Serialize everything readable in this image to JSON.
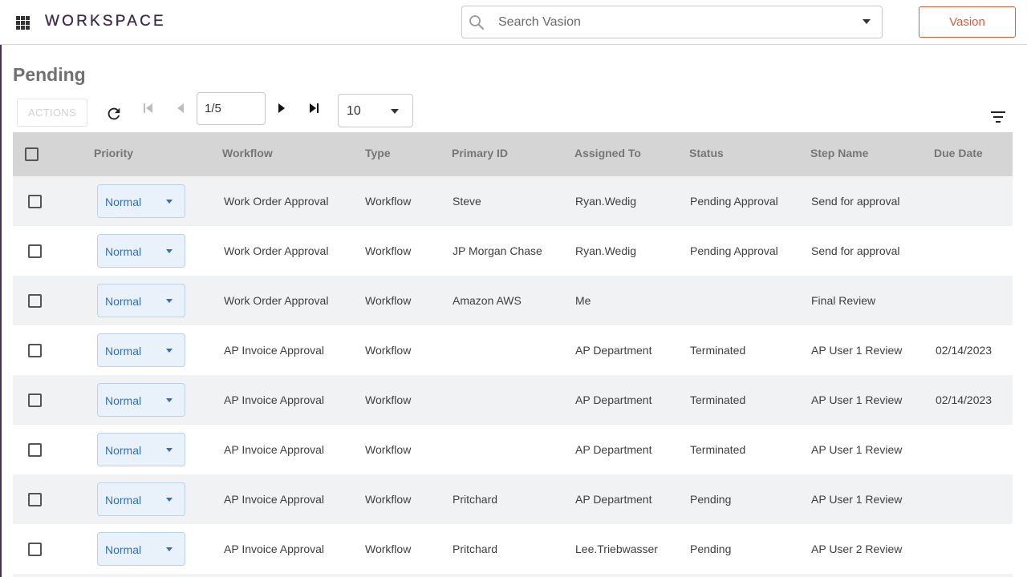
{
  "header": {
    "brand": "WORKSPACE",
    "search_placeholder": "Search Vasion",
    "vasion_label": "Vasion"
  },
  "page": {
    "title": "Pending"
  },
  "toolbar": {
    "actions_label": "ACTIONS",
    "page_value": "1/5",
    "page_size": "10"
  },
  "icons": {
    "apps": "apps-grid-icon",
    "search": "search-icon",
    "refresh": "refresh-icon",
    "first": "first-page-icon",
    "prev": "previous-page-icon",
    "next": "next-page-icon",
    "last": "last-page-icon",
    "filter": "filter-icon"
  },
  "colors": {
    "brand": "#3b2a4e",
    "accent": "#e2593a",
    "priority_text": "#2f6fc0",
    "header_bg": "#d5d5d5",
    "row_alt_bg": "#f1f2f4"
  },
  "table": {
    "columns": [
      "Priority",
      "Workflow",
      "Type",
      "Primary ID",
      "Assigned To",
      "Status",
      "Step Name",
      "Due Date"
    ],
    "rows": [
      {
        "priority": "Normal",
        "workflow": "Work Order Approval",
        "type": "Workflow",
        "primary_id": "Steve",
        "assigned_to": "Ryan.Wedig",
        "status": "Pending Approval",
        "step_name": "Send for approval",
        "due_date": ""
      },
      {
        "priority": "Normal",
        "workflow": "Work Order Approval",
        "type": "Workflow",
        "primary_id": "JP Morgan Chase",
        "assigned_to": "Ryan.Wedig",
        "status": "Pending Approval",
        "step_name": "Send for approval",
        "due_date": ""
      },
      {
        "priority": "Normal",
        "workflow": "Work Order Approval",
        "type": "Workflow",
        "primary_id": "Amazon AWS",
        "assigned_to": "Me",
        "status": "",
        "step_name": "Final Review",
        "due_date": ""
      },
      {
        "priority": "Normal",
        "workflow": "AP Invoice Approval",
        "type": "Workflow",
        "primary_id": "",
        "assigned_to": "AP Department",
        "status": "Terminated",
        "step_name": "AP User 1 Review",
        "due_date": "02/14/2023"
      },
      {
        "priority": "Normal",
        "workflow": "AP Invoice Approval",
        "type": "Workflow",
        "primary_id": "",
        "assigned_to": "AP Department",
        "status": "Terminated",
        "step_name": "AP User 1 Review",
        "due_date": "02/14/2023"
      },
      {
        "priority": "Normal",
        "workflow": "AP Invoice Approval",
        "type": "Workflow",
        "primary_id": "",
        "assigned_to": "AP Department",
        "status": "Terminated",
        "step_name": "AP User 1 Review",
        "due_date": ""
      },
      {
        "priority": "Normal",
        "workflow": "AP Invoice Approval",
        "type": "Workflow",
        "primary_id": "Pritchard",
        "assigned_to": "AP Department",
        "status": "Pending",
        "step_name": "AP User 1 Review",
        "due_date": ""
      },
      {
        "priority": "Normal",
        "workflow": "AP Invoice Approval",
        "type": "Workflow",
        "primary_id": "Pritchard",
        "assigned_to": "Lee.Triebwasser",
        "status": "Pending",
        "step_name": "AP User 2 Review",
        "due_date": ""
      }
    ]
  }
}
